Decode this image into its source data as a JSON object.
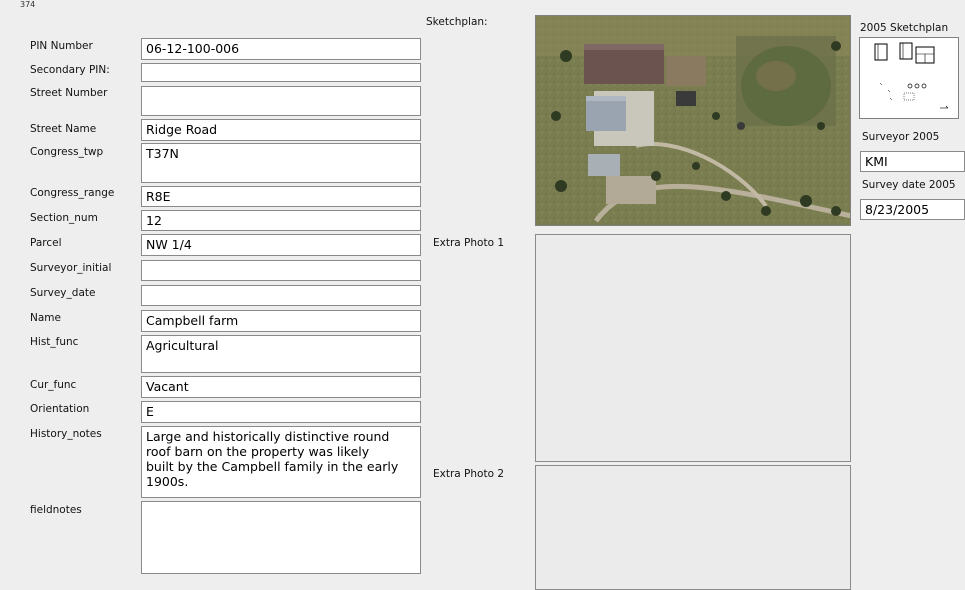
{
  "page_number": "374",
  "fields": [
    {
      "name": "pin-number",
      "label": "PIN Number",
      "value": "06-12-100-006"
    },
    {
      "name": "secondary-pin",
      "label": "Secondary PIN:",
      "value": ""
    },
    {
      "name": "street-number",
      "label": "Street Number",
      "value": ""
    },
    {
      "name": "street-name",
      "label": "Street Name",
      "value": "Ridge Road"
    },
    {
      "name": "congress-twp",
      "label": "Congress_twp",
      "value": "T37N"
    },
    {
      "name": "congress-range",
      "label": "Congress_range",
      "value": "R8E"
    },
    {
      "name": "section-num",
      "label": "Section_num",
      "value": "12"
    },
    {
      "name": "parcel",
      "label": "Parcel",
      "value": "NW 1/4"
    },
    {
      "name": "surveyor-initial",
      "label": "Surveyor_initial",
      "value": ""
    },
    {
      "name": "survey-date",
      "label": "Survey_date",
      "value": ""
    },
    {
      "name": "name",
      "label": "Name",
      "value": "Campbell farm"
    },
    {
      "name": "hist-func",
      "label": "Hist_func",
      "value": "Agricultural"
    },
    {
      "name": "cur-func",
      "label": "Cur_func",
      "value": "Vacant"
    },
    {
      "name": "orientation",
      "label": "Orientation",
      "value": "E"
    },
    {
      "name": "history-notes",
      "label": "History_notes",
      "value": "Large and historically distinctive round roof barn on the property was likely built by the Campbell family in the early 1900s."
    },
    {
      "name": "fieldnotes",
      "label": "fieldnotes",
      "value": ""
    }
  ],
  "photos": {
    "sketchplan_label": "Sketchplan:",
    "extra_photo_1_label": "Extra Photo 1",
    "extra_photo_2_label": "Extra Photo 2"
  },
  "right_panel": {
    "sketchplan_2005_label": "2005 Sketchplan",
    "surveyor_2005_label": "Surveyor 2005",
    "surveyor_2005_value": "KMI",
    "survey_date_2005_label": "Survey date 2005",
    "survey_date_2005_value": "8/23/2005"
  }
}
